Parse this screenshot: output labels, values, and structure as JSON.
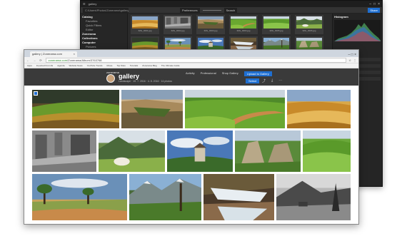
{
  "desktop": {
    "title": "gallery",
    "path": "C:\\Users\\Photos\\Zonerama\\gallery",
    "sort": "Preferences",
    "search": "Search",
    "panel_button": "Share",
    "tree": [
      {
        "label": "Catalog",
        "level": 0
      },
      {
        "label": "Favorites",
        "level": 1
      },
      {
        "label": "Quick Filters",
        "level": 1
      },
      {
        "label": "Editor",
        "level": 1
      },
      {
        "label": "Zonerama",
        "level": 0
      },
      {
        "label": "Collections",
        "level": 0
      },
      {
        "label": "Computer",
        "level": 0
      },
      {
        "label": "Pictures",
        "level": 1
      },
      {
        "label": "Desktop",
        "level": 1
      },
      {
        "label": "Documents",
        "level": 1
      },
      {
        "label": "Music",
        "level": 1
      },
      {
        "label": "Videos",
        "level": 1
      }
    ],
    "thumbs": [
      "IMG_0001.jpg",
      "IMG_0002.jpg",
      "IMG_0003.jpg",
      "IMG_0004.jpg",
      "IMG_0005.jpg",
      "IMG_0006.jpg",
      "IMG_0007.jpg",
      "IMG_0008.jpg",
      "IMG_0009.jpg",
      "IMG_0010.jpg",
      "IMG_0011.jpg",
      "IMG_0012.jpg"
    ],
    "panel": {
      "header": "Histogram",
      "tabs": [
        "Info",
        "Edit"
      ]
    }
  },
  "browser": {
    "tab_title": "gallery | Zonerama.com",
    "url_secure": "zonerama.com",
    "url_path": "/Zonerama/Album/3763768",
    "bookmarks": [
      "Apps",
      "Imported From IE",
      "Agenda",
      "Website News",
      "YouTube Trends",
      "Movie",
      "Top Sites",
      "Tutorials",
      "Zonerama Blog",
      "The Ultimate Guide"
    ],
    "site": {
      "logo": "zonerama",
      "gallery_title": "gallery",
      "gallery_sub": "Landscape · 19. 7. 2016 · 4. 8. 2016 · 14 photos",
      "nav": [
        "Activity",
        "Professional",
        "Shop Gallery"
      ],
      "upload": "Upload to Gallery",
      "select": "Select"
    },
    "photos": [
      {
        "theme": "green-hills"
      },
      {
        "theme": "canyon"
      },
      {
        "theme": "green-field"
      },
      {
        "theme": "golden-field"
      },
      {
        "theme": "bw-ruins"
      },
      {
        "theme": "mountain-goat"
      },
      {
        "theme": "castle-sky"
      },
      {
        "theme": "rocks-green"
      },
      {
        "theme": "rolling-green"
      },
      {
        "theme": "savanna-tree"
      },
      {
        "theme": "alpine-village"
      },
      {
        "theme": "waterfall"
      },
      {
        "theme": "bw-mountain"
      }
    ]
  }
}
